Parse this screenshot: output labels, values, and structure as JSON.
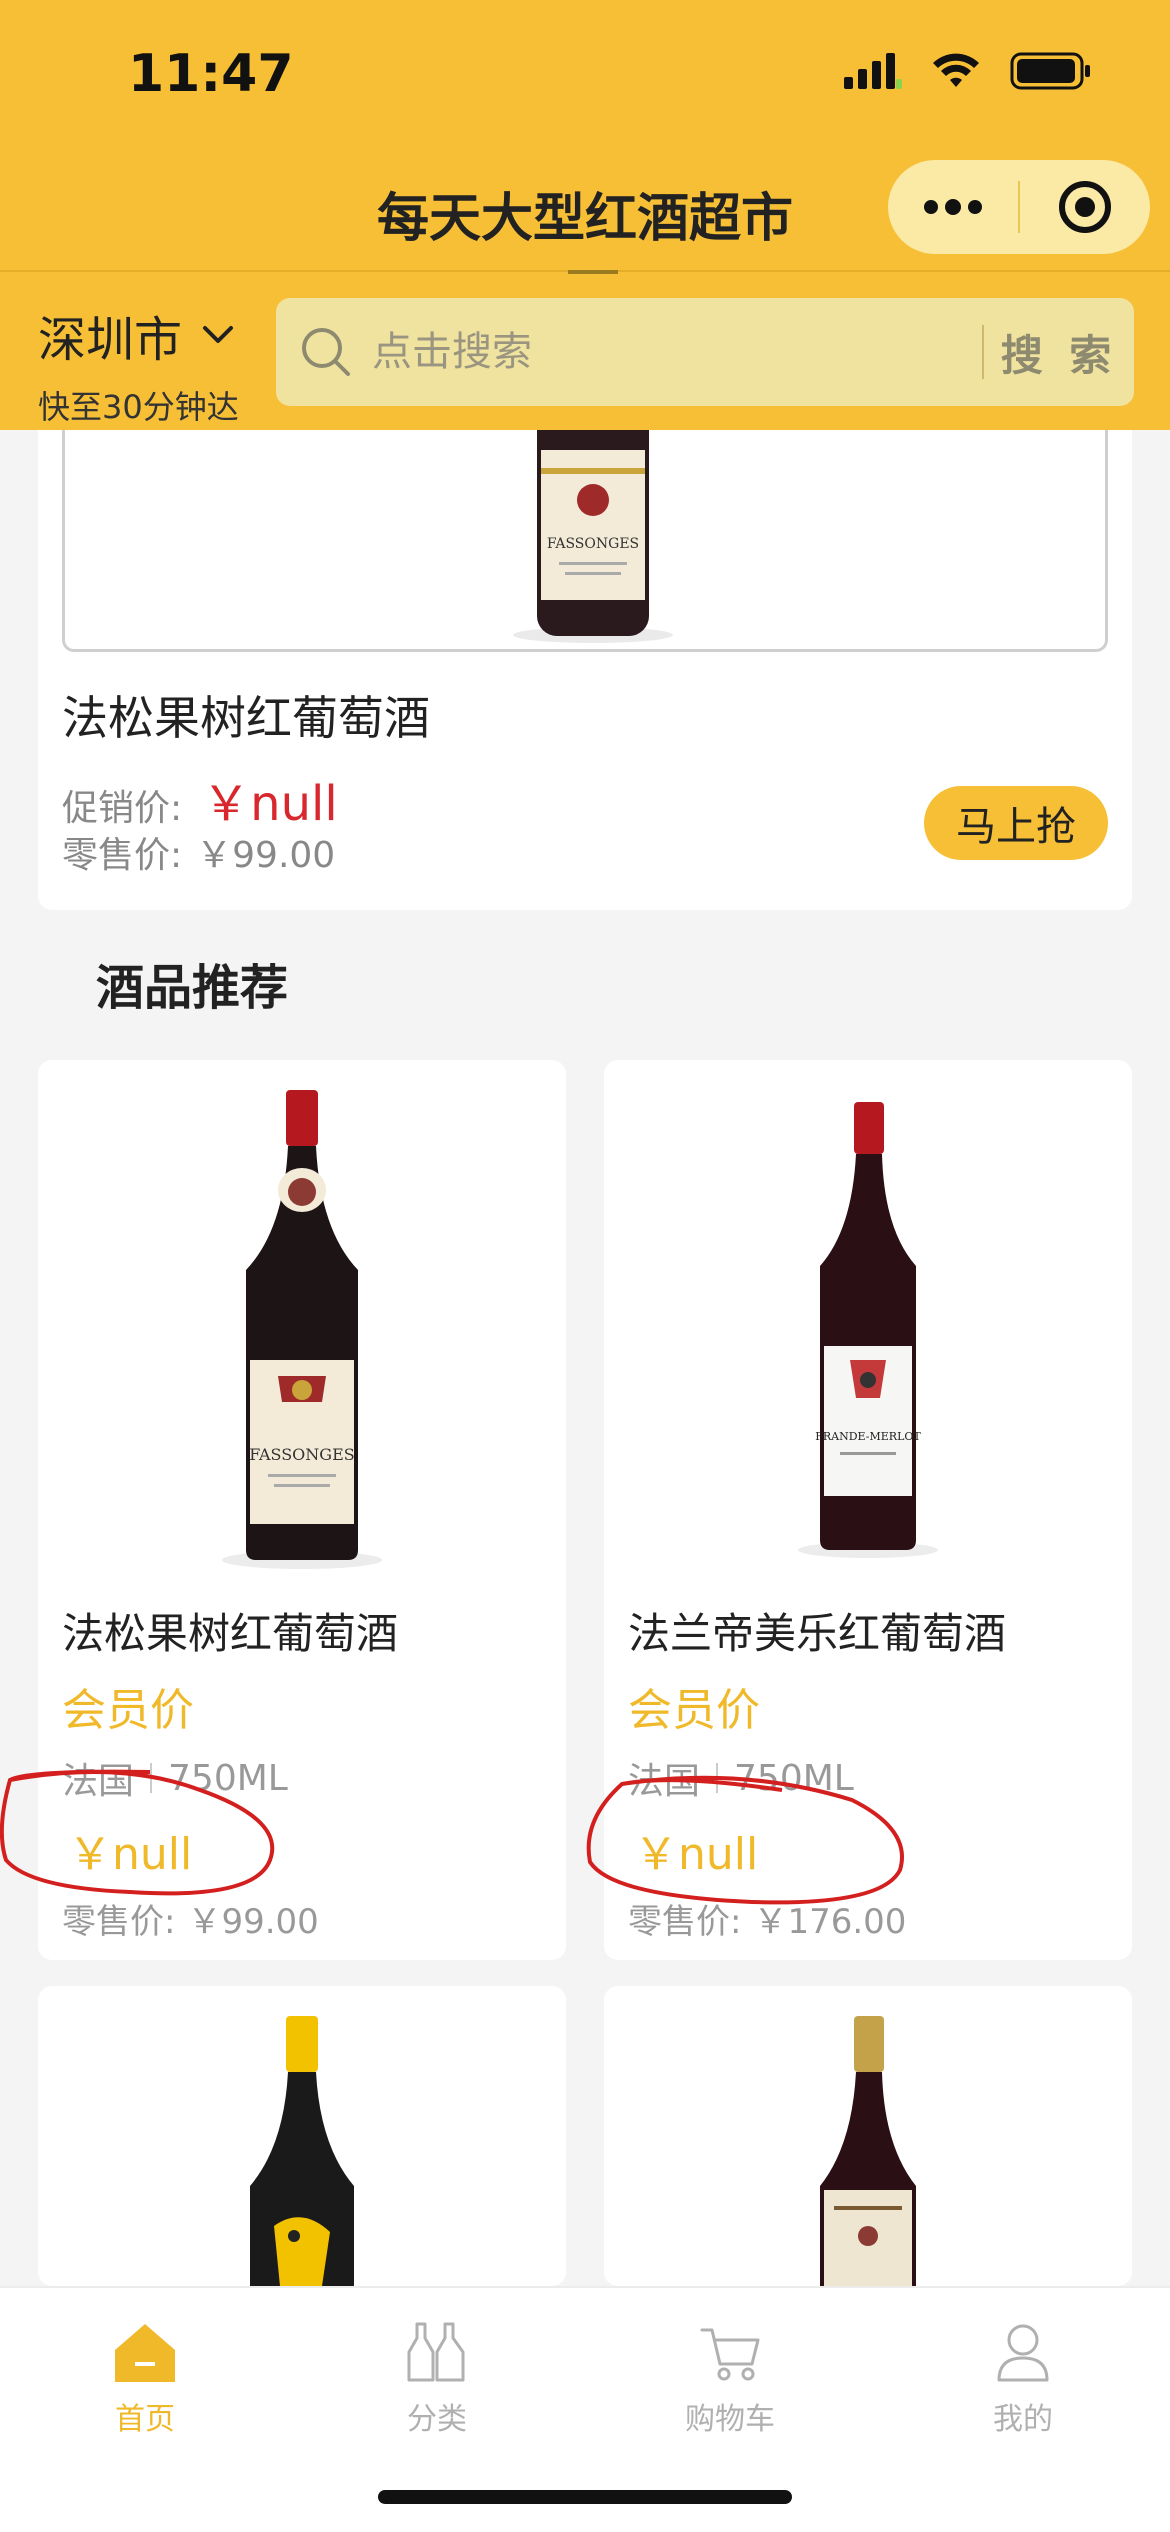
{
  "status_bar": {
    "time": "11:47"
  },
  "header": {
    "title": "每天大型红酒超市"
  },
  "location": {
    "city": "深圳市",
    "delivery": "快至30分钟达"
  },
  "search": {
    "placeholder": "点击搜索",
    "button": "搜 索"
  },
  "featured": {
    "name": "法松果树红葡萄酒",
    "promo_label": "促销价:",
    "promo_price": "￥null",
    "retail_label": "零售价:",
    "retail_price": "￥99.00",
    "buy_button": "马上抢",
    "bottle_label": "FASSONGES"
  },
  "section_title": "酒品推荐",
  "products": [
    {
      "name": "法松果树红葡萄酒",
      "member_label": "会员价",
      "country": "法国",
      "volume": "750ML",
      "price": "￥null",
      "retail_label": "零售价:",
      "retail_price": "￥99.00",
      "bottle_label": "FASSONGES"
    },
    {
      "name": "法兰帝美乐红葡萄酒",
      "member_label": "会员价",
      "country": "法国",
      "volume": "750ML",
      "price": "￥null",
      "retail_label": "零售价:",
      "retail_price": "￥176.00",
      "bottle_label": "FRANDE-MERLOT"
    }
  ],
  "tabs": [
    {
      "label": "首页",
      "icon": "home-icon",
      "active": true
    },
    {
      "label": "分类",
      "icon": "bottles-icon",
      "active": false
    },
    {
      "label": "购物车",
      "icon": "cart-icon",
      "active": false
    },
    {
      "label": "我的",
      "icon": "user-icon",
      "active": false
    }
  ],
  "colors": {
    "brand_yellow": "#f6bf36",
    "promo_red": "#d8272d",
    "member_gold": "#f0b92a",
    "annotation_red": "#d41f1f"
  }
}
